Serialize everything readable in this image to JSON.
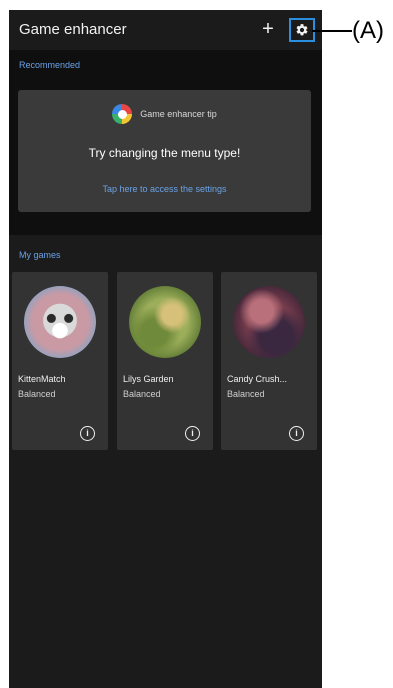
{
  "app_bar": {
    "title": "Game enhancer",
    "add_icon": "plus-icon",
    "add_symbol": "+",
    "settings_icon": "gear-icon"
  },
  "recommended": {
    "label": "Recommended",
    "tip_card": {
      "logo_icon": "game-enhancer-logo-icon",
      "title": "Game enhancer tip",
      "message": "Try changing the menu type!",
      "link": "Tap here to access the settings"
    }
  },
  "my_games": {
    "label": "My games",
    "items": [
      {
        "name": "KittenMatch",
        "mode": "Balanced",
        "info_icon": "info-icon",
        "info_symbol": "i",
        "avatar": "kitten-game-thumbnail"
      },
      {
        "name": "Lilys Garden",
        "mode": "Balanced",
        "info_icon": "info-icon",
        "info_symbol": "i",
        "avatar": "garden-game-thumbnail"
      },
      {
        "name": "Candy Crush...",
        "mode": "Balanced",
        "info_icon": "info-icon",
        "info_symbol": "i",
        "avatar": "candy-game-thumbnail"
      }
    ]
  },
  "annotation": {
    "label": "(A)"
  },
  "colors": {
    "background": "#1b1b1b",
    "panel": "#0f0f0f",
    "card": "#333333",
    "accent": "#6aa2e6",
    "highlight": "#2b8fe0"
  }
}
